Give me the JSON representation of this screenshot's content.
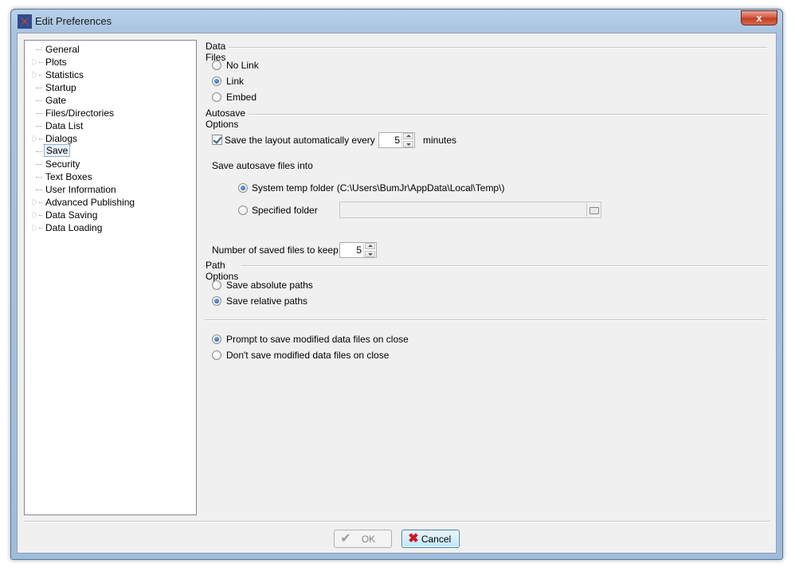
{
  "window": {
    "title": "Edit Preferences",
    "close_label": "x"
  },
  "tree": {
    "items": [
      {
        "label": "General",
        "expandable": false
      },
      {
        "label": "Plots",
        "expandable": true
      },
      {
        "label": "Statistics",
        "expandable": true
      },
      {
        "label": "Startup",
        "expandable": false
      },
      {
        "label": "Gate",
        "expandable": false
      },
      {
        "label": "Files/Directories",
        "expandable": false
      },
      {
        "label": "Data List",
        "expandable": false
      },
      {
        "label": "Dialogs",
        "expandable": true
      },
      {
        "label": "Save",
        "expandable": false,
        "selected": true
      },
      {
        "label": "Security",
        "expandable": false
      },
      {
        "label": "Text Boxes",
        "expandable": false
      },
      {
        "label": "User Information",
        "expandable": false
      },
      {
        "label": "Advanced Publishing",
        "expandable": true
      },
      {
        "label": "Data Saving",
        "expandable": true
      },
      {
        "label": "Data Loading",
        "expandable": true
      }
    ]
  },
  "data_files": {
    "header": "Data Files",
    "options": [
      {
        "label": "No Link",
        "checked": false
      },
      {
        "label": "Link",
        "checked": true
      },
      {
        "label": "Embed",
        "checked": false
      }
    ]
  },
  "autosave": {
    "header": "Autosave Options",
    "checkbox_label": "Save the layout automatically every",
    "checked": true,
    "minutes_value": "5",
    "minutes_label": "minutes",
    "save_into_label": "Save autosave files into",
    "system_temp_label": "System temp folder (C:\\Users\\BumJr\\AppData\\Local\\Temp\\)",
    "specified_folder_label": "Specified folder",
    "specified_folder_value": "",
    "keep_label": "Number of saved files to keep:",
    "keep_value": "5"
  },
  "path_options": {
    "header": "Path Options",
    "options": [
      {
        "label": "Save absolute paths",
        "checked": false
      },
      {
        "label": "Save relative paths",
        "checked": true
      }
    ]
  },
  "close_options": {
    "options": [
      {
        "label": "Prompt to save modified data files on close",
        "checked": true
      },
      {
        "label": "Don't save modified data files on close",
        "checked": false
      }
    ]
  },
  "buttons": {
    "ok_label": "OK",
    "cancel_label": "Cancel"
  },
  "colors": {
    "title_bar": "#b9d1ea",
    "close_button": "#c23b1f",
    "radio_dot": "#1d5aa6",
    "cancel_icon": "#d8141e",
    "ok_icon": "#9a9a9a"
  },
  "icons": {
    "app": "app-logo-icon",
    "ok": "check-icon",
    "cancel": "x-icon",
    "folder": "folder-browse-icon"
  }
}
